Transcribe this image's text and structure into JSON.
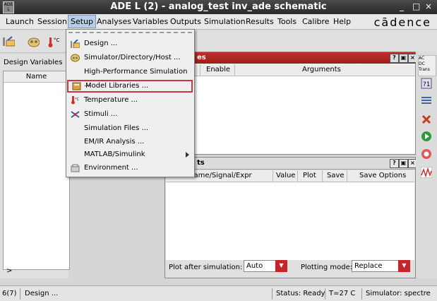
{
  "window": {
    "title": "ADE L (2) - analog_test inv_ade schematic",
    "app_icon_text": "ADE L",
    "minimize": "_",
    "maximize": "□",
    "close": "×"
  },
  "menubar": {
    "items": [
      "Launch",
      "Session",
      "Setup",
      "Analyses",
      "Variables",
      "Outputs",
      "Simulation",
      "Results",
      "Tools",
      "Calibre",
      "Help"
    ],
    "active": "Setup",
    "brand": "cādence"
  },
  "left_panel": {
    "label": "Design Variables",
    "column_header": "Name",
    "prompt": ">"
  },
  "analyses_panel": {
    "title_suffix": "es",
    "columns": [
      "Enable",
      "Arguments"
    ]
  },
  "outputs_panel": {
    "title_suffix": "ts",
    "columns": [
      "Name/Signal/Expr",
      "Value",
      "Plot",
      "Save",
      "Save Options"
    ],
    "plot_after_label": "Plot after simulation:",
    "plot_after_value": "Auto",
    "plotting_mode_label": "Plotting mode:",
    "plotting_mode_value": "Replace"
  },
  "right_toolbar": {
    "analysis_types": [
      "AC",
      "DC",
      "Trans"
    ]
  },
  "setup_menu": {
    "items": [
      {
        "label": "Design ...",
        "icon": "design-icon"
      },
      {
        "label": "Simulator/Directory/Host ...",
        "icon": "simulator-icon"
      },
      {
        "label": "High-Performance Simulation ...",
        "icon": ""
      },
      {
        "label": "Model Libraries ...",
        "icon": "model-libraries-icon",
        "highlighted": true
      },
      {
        "label": "Temperature ...",
        "icon": "thermometer-icon"
      },
      {
        "label": "Stimuli ...",
        "icon": "stimuli-icon"
      },
      {
        "label": "Simulation Files ...",
        "icon": ""
      },
      {
        "label": "EM/IR Analysis ...",
        "icon": ""
      },
      {
        "label": "MATLAB/Simulink",
        "icon": "",
        "submenu": true
      },
      {
        "label": "Environment ...",
        "icon": "environment-icon"
      }
    ]
  },
  "statusbar": {
    "line": "6(7)",
    "message": "Design ...",
    "status": "Status: Ready",
    "temperature": "T=27  C",
    "simulator": "Simulator: spectre"
  },
  "colors": {
    "panel_title_red": "#b02a25",
    "highlight_border": "#c8393a",
    "menu_active": "#b8cde6"
  }
}
